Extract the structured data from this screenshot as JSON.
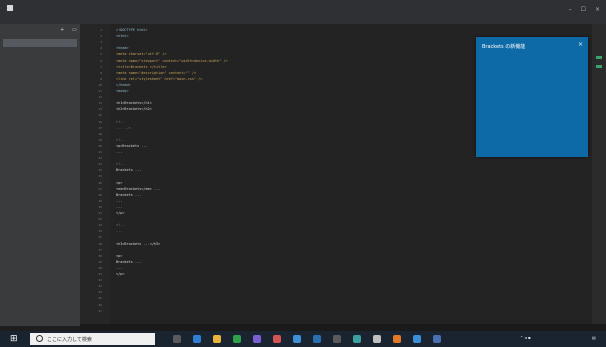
{
  "window": {
    "title": "",
    "menu": [
      "",
      "",
      "",
      "",
      "",
      "",
      ""
    ]
  },
  "sidebar": {
    "header": "",
    "file": "",
    "outline_header": "",
    "outline_items": [
      "",
      "",
      "",
      ""
    ]
  },
  "editor": {
    "line_numbers": [
      "1",
      "2",
      "3",
      "4",
      "5",
      "6",
      "7",
      "8",
      "9",
      "10",
      "11",
      "12",
      "13",
      "14",
      "15",
      "16",
      "17",
      "18",
      "19",
      "20",
      "21",
      "22",
      "23",
      "24",
      "25",
      "26",
      "27",
      "28",
      "29",
      "30",
      "31",
      "32",
      "33",
      "34",
      "35",
      "36",
      "37",
      "38",
      "39",
      "40",
      "41",
      "42",
      "43",
      "44",
      "45",
      "46",
      "47"
    ],
    "lines": [
      {
        "cls": "tag",
        "text": "<!DOCTYPE html>"
      },
      {
        "cls": "tag",
        "text": "<html>"
      },
      {
        "cls": "text",
        "text": ""
      },
      {
        "cls": "tag",
        "text": "  <head>"
      },
      {
        "cls": "attr",
        "text": "    <meta charset=\"utf-8\" />"
      },
      {
        "cls": "attr",
        "text": "    <meta name=\"viewport\" content=\"width=device-width\" />"
      },
      {
        "cls": "attr",
        "text": "    <title>Brackets </title>"
      },
      {
        "cls": "attr",
        "text": "    <meta name=\"description\" content=\"\" />"
      },
      {
        "cls": "attr",
        "text": "    <link rel=\"stylesheet\" href=\"main.css\" />"
      },
      {
        "cls": "tag",
        "text": "  </head>"
      },
      {
        "cls": "tag",
        "text": "  <body>"
      },
      {
        "cls": "text",
        "text": ""
      },
      {
        "cls": "text",
        "text": "    <h1>Brackets</h1>"
      },
      {
        "cls": "text",
        "text": "    <h2>Brackets</h2>"
      },
      {
        "cls": "text",
        "text": ""
      },
      {
        "cls": "comment",
        "text": "    <!--"
      },
      {
        "cls": "comment",
        "text": "       ...  -->"
      },
      {
        "cls": "text",
        "text": ""
      },
      {
        "cls": "comment",
        "text": "    <!--"
      },
      {
        "cls": "text",
        "text": "    <p>Brackets ..."
      },
      {
        "cls": "text",
        "text": "       ..."
      },
      {
        "cls": "text",
        "text": ""
      },
      {
        "cls": "comment",
        "text": "    <!--"
      },
      {
        "cls": "text",
        "text": "       Brackets ..."
      },
      {
        "cls": "text",
        "text": ""
      },
      {
        "cls": "text",
        "text": "    <p>"
      },
      {
        "cls": "text",
        "text": "       <em>Brackets</em> ..."
      },
      {
        "cls": "text",
        "text": "       Brackets ..."
      },
      {
        "cls": "text",
        "text": "       ..."
      },
      {
        "cls": "text",
        "text": "       ..."
      },
      {
        "cls": "text",
        "text": "    </p>"
      },
      {
        "cls": "text",
        "text": ""
      },
      {
        "cls": "comment",
        "text": "    <!--"
      },
      {
        "cls": "comment",
        "text": "       ..."
      },
      {
        "cls": "text",
        "text": ""
      },
      {
        "cls": "text",
        "text": "    <h3>Brackets ...</h3>"
      },
      {
        "cls": "text",
        "text": ""
      },
      {
        "cls": "text",
        "text": "    <p>"
      },
      {
        "cls": "text",
        "text": "       Brackets ..."
      },
      {
        "cls": "text",
        "text": "       ..."
      },
      {
        "cls": "text",
        "text": "    </p>"
      },
      {
        "cls": "text",
        "text": ""
      },
      {
        "cls": "text",
        "text": ""
      },
      {
        "cls": "text",
        "text": ""
      },
      {
        "cls": "text",
        "text": ""
      },
      {
        "cls": "text",
        "text": ""
      },
      {
        "cls": "text",
        "text": ""
      }
    ]
  },
  "notification": {
    "title": "Brackets の新機能",
    "lines": [
      "",
      "",
      "",
      "",
      "",
      "",
      "",
      "",
      "",
      "",
      "",
      ""
    ],
    "link": ""
  },
  "statusbar": {
    "left": "",
    "right": [
      "",
      "",
      "",
      ""
    ]
  },
  "taskbar": {
    "search_placeholder": "ここに入力して検索",
    "clock": [
      "",
      ""
    ]
  }
}
